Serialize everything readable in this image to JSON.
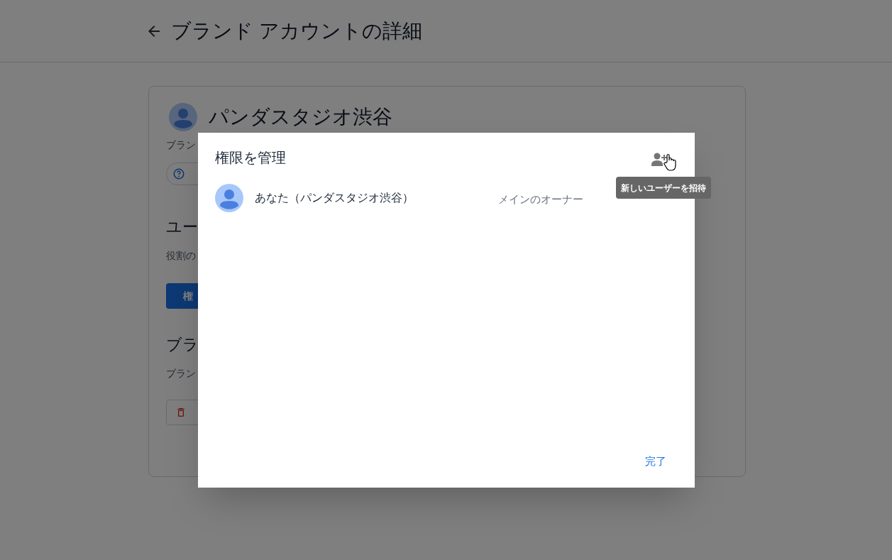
{
  "page": {
    "title": "ブランド アカウントの詳細"
  },
  "card": {
    "name": "パンダスタジオ渋谷",
    "description": "ブラン",
    "users_heading": "ユー",
    "users_text": "役割の",
    "permissions_button": "権",
    "brand_heading": "ブラ",
    "brand_text": "ブラン"
  },
  "dialog": {
    "title": "権限を管理",
    "tooltip": "新しいユーザーを招待",
    "members": [
      {
        "name": "あなた（パンダスタジオ渋谷）",
        "role": "メインのオーナー"
      }
    ],
    "done_button": "完了"
  }
}
